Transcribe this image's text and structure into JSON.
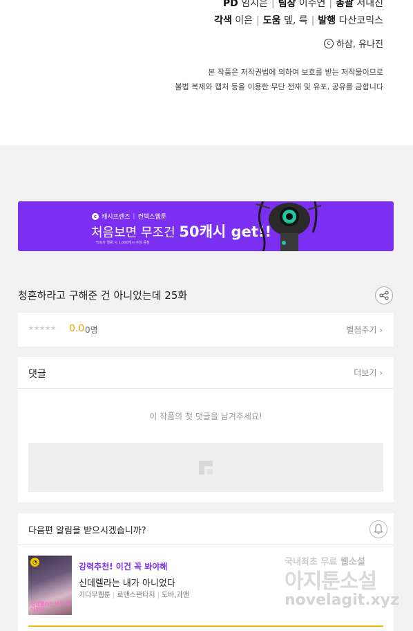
{
  "credits": {
    "line1": [
      {
        "role": "PD",
        "name": "임지은"
      },
      {
        "role": "팀장",
        "name": "이주연"
      },
      {
        "role": "총괄",
        "name": "서내진"
      }
    ],
    "line2": [
      {
        "role": "각색",
        "name": "이은"
      },
      {
        "role": "도움",
        "name": "뎊, 륵"
      },
      {
        "role": "발행",
        "name": "다산코믹스"
      }
    ],
    "copyright_symbol": "c",
    "copyright": "하삼, 유나진",
    "notice_line1": "본 작품은 저작권법에 의하여 보호를 받는 저작물이므로",
    "notice_line2": "불법 복제와 캡처 등을 이용한 무단 전재 및 유포, 공유를 금합니다"
  },
  "banner": {
    "brand_left": "캐시프렌즈",
    "brand_sep": "|",
    "brand_right": "컨텍스웹툰",
    "title_pre": "처음보면 무조건 ",
    "title_big": "50캐시 get!!",
    "fine_print": "*5회차 열람 시 1,000캐시 추첨 증정",
    "accent": "#7b2ff0"
  },
  "episode": {
    "title": "청혼하라고 구해준 건 아니었는데 25화",
    "share_icon": "share-icon"
  },
  "rating": {
    "stars": "★★★★★",
    "value": "0.0",
    "count": "0명",
    "rate_link": "별점주기 ›"
  },
  "comments": {
    "title": "댓글",
    "more_link": "더보기 ›",
    "empty_text": "이 작품의 첫 댓글을 남겨주세요!"
  },
  "alert": {
    "title": "다음편 알림을 받으시겠습니까?",
    "recommend_tag": "강력추천! 이건 꼭 봐야해",
    "recommend_name": "신데렐라는 내가 아니었다",
    "genres": [
      "기다무웹툰",
      "로맨스판타지",
      "도바,과앤"
    ],
    "thumb_text": "신데렐라는 내가 아니었다"
  },
  "watermark": {
    "line1_pre": "국내최초 무료 ",
    "line1_hl": "웹소설",
    "line2": "아지툰소설",
    "line3": "novelagit.xyz"
  }
}
